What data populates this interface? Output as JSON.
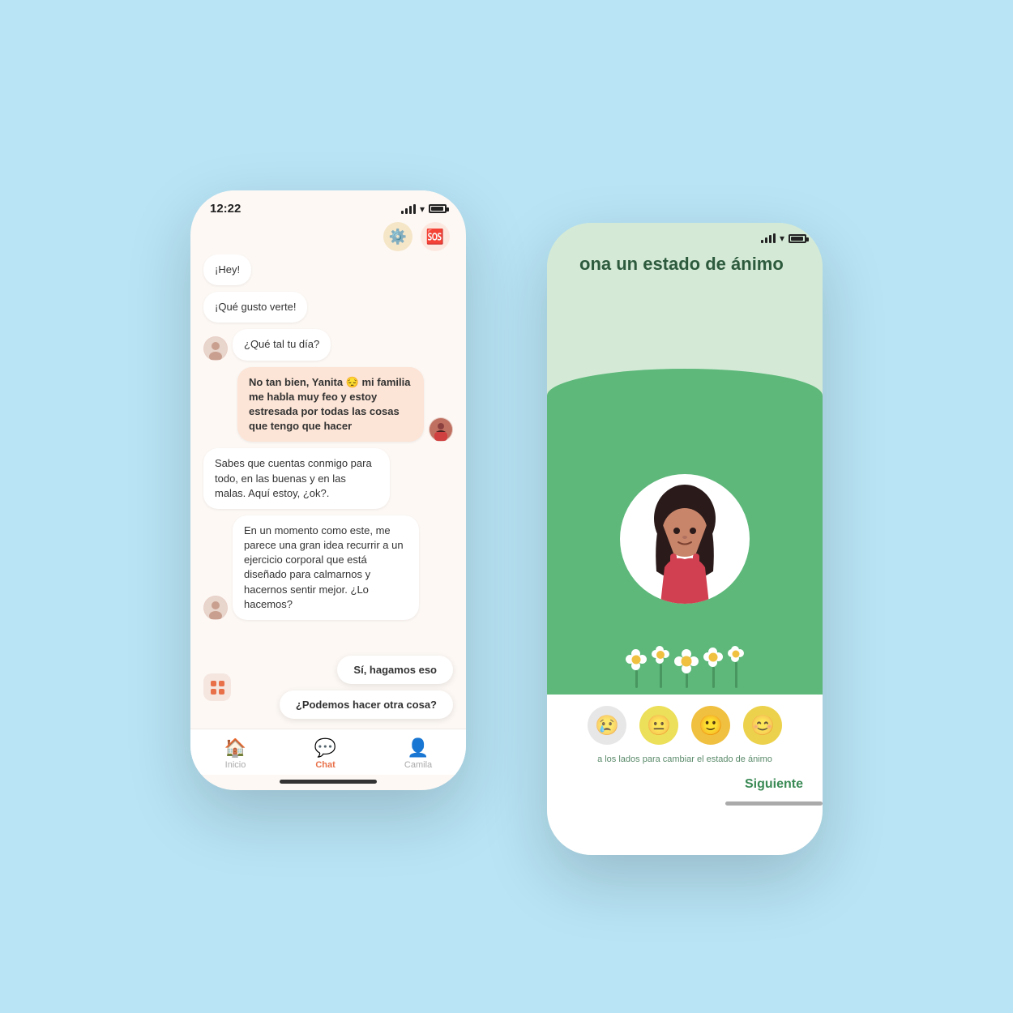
{
  "phone_chat": {
    "status_time": "12:22",
    "header_icons": {
      "gear": "⚙️",
      "help": "🆘"
    },
    "messages": [
      {
        "id": 1,
        "type": "bot",
        "text": "¡Hey!",
        "has_avatar": false
      },
      {
        "id": 2,
        "type": "bot",
        "text": "¡Qué gusto verte!",
        "has_avatar": false
      },
      {
        "id": 3,
        "type": "bot",
        "text": "¿Qué tal tu día?",
        "has_avatar": true
      },
      {
        "id": 4,
        "type": "user",
        "text": "No tan bien, Yanita 😔 mi familia me habla muy feo y estoy estresada por todas las cosas que tengo que hacer",
        "has_avatar": true
      },
      {
        "id": 5,
        "type": "bot",
        "text": "Sabes que cuentas conmigo para todo, en las buenas y en las malas. Aquí estoy, ¿ok?.",
        "has_avatar": false
      },
      {
        "id": 6,
        "type": "bot",
        "text": "En un momento como este, me parece una gran idea recurrir a un ejercicio corporal que está diseñado para calmarnos y hacernos sentir mejor. ¿Lo hacemos?",
        "has_avatar": true
      }
    ],
    "quick_replies": [
      {
        "id": 1,
        "text": "Sí, hagamos eso"
      },
      {
        "id": 2,
        "text": "¿Podemos hacer otra cosa?"
      }
    ],
    "tabs": [
      {
        "id": "inicio",
        "label": "Inicio",
        "icon": "🏠",
        "active": false
      },
      {
        "id": "chat",
        "label": "Chat",
        "icon": "💬",
        "active": true
      },
      {
        "id": "camila",
        "label": "Camila",
        "icon": "👤",
        "active": false
      }
    ]
  },
  "phone_mood": {
    "title": "ona un estado de ánimo",
    "hint_text": "a los lados para cambiar el estado de ánimo",
    "next_label": "Siguiente",
    "emojis": [
      "😢",
      "😐",
      "🙂",
      "😊"
    ],
    "active_emoji_index": 2
  }
}
